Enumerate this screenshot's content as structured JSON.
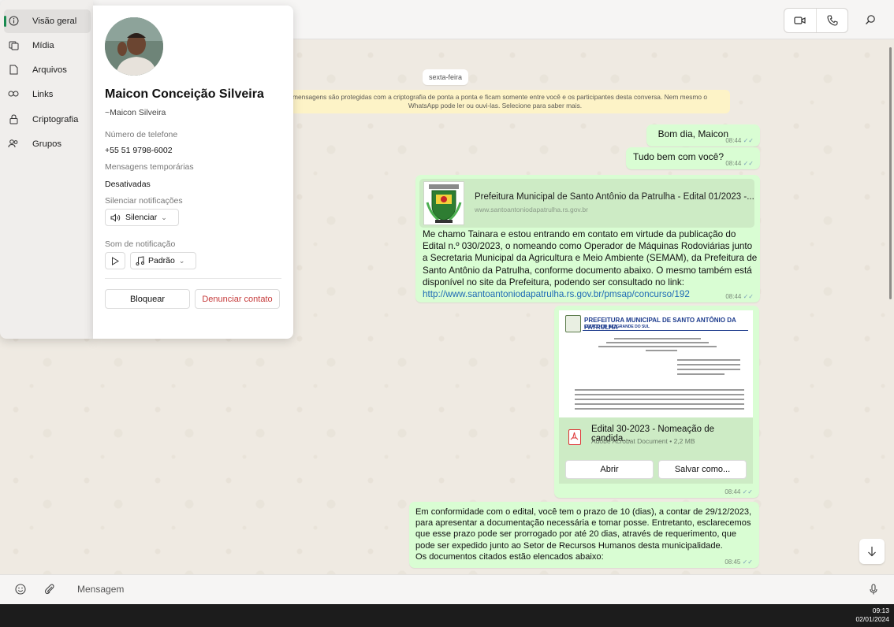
{
  "topbar": {
    "video_label": "Video call",
    "voice_label": "Voice call",
    "search_label": "Search"
  },
  "nav": {
    "items": [
      {
        "label": "Visão geral",
        "icon": "info-icon",
        "active": true
      },
      {
        "label": "Mídia",
        "icon": "media-icon"
      },
      {
        "label": "Arquivos",
        "icon": "document-icon"
      },
      {
        "label": "Links",
        "icon": "link-icon"
      },
      {
        "label": "Criptografia",
        "icon": "lock-icon"
      },
      {
        "label": "Grupos",
        "icon": "people-icon"
      }
    ]
  },
  "contact": {
    "name": "Maicon Conceição Silveira",
    "handle": "~Maicon Silveira",
    "phone_label": "Número de telefone",
    "phone": "+55 51 9798-6002",
    "temp_label": "Mensagens temporárias",
    "temp_value": "Desativadas",
    "mute_label": "Silenciar notificações",
    "mute_button": "Silenciar",
    "sound_label": "Som de notificação",
    "sound_value": "Padrão",
    "block": "Bloquear",
    "report": "Denunciar contato"
  },
  "chat": {
    "date_chip": "sexta-feira",
    "encryption_notice": "As mensagens são protegidas com a criptografia de ponta a ponta e ficam somente entre você e os participantes desta conversa. Nem mesmo o WhatsApp pode ler ou ouvi-las. Selecione para saber mais.",
    "messages": [
      {
        "text": "Bom dia, Maicon",
        "time": "08:44"
      },
      {
        "text": "Tudo bem com você?",
        "time": "08:44"
      },
      {
        "preview_title": "Prefeitura Municipal de Santo Antônio da Patrulha - Edital 01/2023 -...",
        "preview_url": "www.santoantoniodapatrulha.rs.gov.br",
        "text": "Me chamo Tainara e estou entrando em contato em virtude da publicação do Edital n.º 030/2023, o nomeando como Operador de Máquinas Rodoviárias junto a Secretaria Municipal da Agricultura e Meio Ambiente (SEMAM), da Prefeitura de Santo Antônio da Patrulha, conforme documento abaixo. O mesmo também está disponível no site da Prefeitura, podendo ser consultado no link:",
        "link": "http://www.santoantoniodapatrulha.rs.gov.br/pmsap/concurso/192",
        "time": "08:44"
      },
      {
        "doc_header": "PREFEITURA MUNICIPAL DE SANTO ANTÔNIO DA PATRULHA",
        "doc_subheader": "ESTADO DO RIO GRANDE DO SUL",
        "doc_name": "Edital 30-2023 - Nomeação de candida...",
        "doc_info": "Adobe Acrobat Document • 2,2 MB",
        "open": "Abrir",
        "save": "Salvar como...",
        "time": "08:44"
      },
      {
        "text": "Em conformidade com o edital, você tem o prazo de 10 (dias), a contar de 29/12/2023, para apresentar a documentação necessária e tomar posse. Entretanto, esclarecemos que esse prazo pode ser prorrogado por até 20 dias, através de requerimento, que pode ser expedido junto ao Setor de Recursos Humanos desta municipalidade.",
        "text2": "Os documentos citados estão elencados abaixo:",
        "time": "08:45"
      }
    ]
  },
  "composer": {
    "placeholder": "Mensagem"
  },
  "taskbar": {
    "time": "09:13",
    "date": "02/01/2024"
  },
  "colors": {
    "bubble": "#d9fdd3",
    "accent": "#1a8a50",
    "link": "#1f6bb5",
    "report": "#c53a3a"
  }
}
